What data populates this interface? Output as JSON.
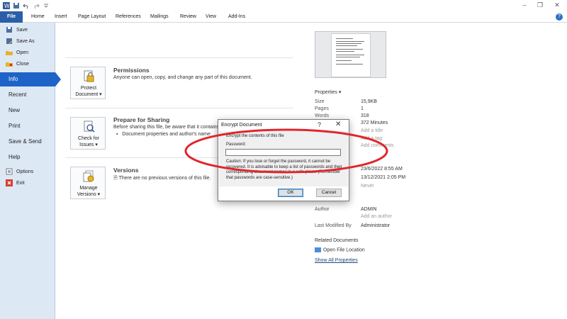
{
  "quick_access": {
    "icons": [
      "word-app-icon",
      "save-icon",
      "undo-icon",
      "redo-icon",
      "customize-icon"
    ]
  },
  "window_controls": {
    "minimize": "–",
    "restore": "❐",
    "close": "✕"
  },
  "ribbon": {
    "tabs": [
      {
        "label": "File",
        "active": true
      },
      {
        "label": "Home"
      },
      {
        "label": "Insert"
      },
      {
        "label": "Page Layout"
      },
      {
        "label": "References"
      },
      {
        "label": "Mailings"
      },
      {
        "label": "Review"
      },
      {
        "label": "View"
      },
      {
        "label": "Add-Ins"
      }
    ],
    "help_glyph": "?"
  },
  "nav": {
    "small_top": [
      {
        "label": "Save",
        "icon": "save-icon"
      },
      {
        "label": "Save As",
        "icon": "save-as-icon"
      },
      {
        "label": "Open",
        "icon": "open-folder-icon"
      },
      {
        "label": "Close",
        "icon": "close-doc-icon"
      }
    ],
    "big": [
      {
        "label": "Info",
        "active": true
      },
      {
        "label": "Recent"
      },
      {
        "label": "New"
      },
      {
        "label": "Print"
      },
      {
        "label": "Save & Send"
      },
      {
        "label": "Help"
      }
    ],
    "small_bottom": [
      {
        "label": "Options",
        "icon": "options-icon"
      },
      {
        "label": "Exit",
        "icon": "exit-icon"
      }
    ]
  },
  "info": {
    "permissions": {
      "button_label": "Protect Document ▾",
      "title": "Permissions",
      "text": "Anyone can open, copy, and change any part of this document."
    },
    "sharing": {
      "button_label": "Check for Issues ▾",
      "title": "Prepare for Sharing",
      "text": "Before sharing this file, be aware that it contains:",
      "bullet": "Document properties and author's name"
    },
    "versions": {
      "button_label": "Manage Versions ▾",
      "title": "Versions",
      "text": "There are no previous versions of this file."
    }
  },
  "properties": {
    "header": "Properties ▾",
    "rows": [
      {
        "key": "Size",
        "value": "15,9KB"
      },
      {
        "key": "Pages",
        "value": "1"
      },
      {
        "key": "Words",
        "value": "318"
      },
      {
        "key": "",
        "value": "372 Minutes"
      },
      {
        "key": "",
        "value": "Add a title",
        "dim": true
      },
      {
        "key": "",
        "value": "Add a tag",
        "dim": true
      },
      {
        "key": "",
        "value": "Add comments",
        "dim": true
      }
    ],
    "dates": [
      {
        "key": "",
        "value": "23/6/2022 8:55 AM"
      },
      {
        "key": "",
        "value": "13/12/2021 2:05 PM"
      },
      {
        "key": "",
        "value": "Never",
        "dim": true
      }
    ],
    "people": [
      {
        "key": "Author",
        "value": "ADMIN"
      },
      {
        "key": "",
        "value": "Add an author",
        "dim": true
      },
      {
        "key": "Last Modified By",
        "value": "Administrator"
      }
    ],
    "related_header": "Related Documents",
    "open_location": "Open File Location",
    "show_all": "Show All Properties"
  },
  "dialog": {
    "title": "Encrypt Document",
    "help": "?",
    "close": "✕",
    "intro": "Encrypt the contents of this file",
    "password_label": "Password:",
    "password_value": "",
    "caution": "Caution: If you lose or forget the password, it cannot be recovered. It is advisable to keep a list of passwords and their corresponding document names in a safe place. (Remember that passwords are case-sensitive.)",
    "ok_label": "OK",
    "cancel_label": "Cancel"
  },
  "colors": {
    "file_tab": "#2a5ea8",
    "nav_active": "#1e63c8",
    "annotation": "#e0262b"
  }
}
